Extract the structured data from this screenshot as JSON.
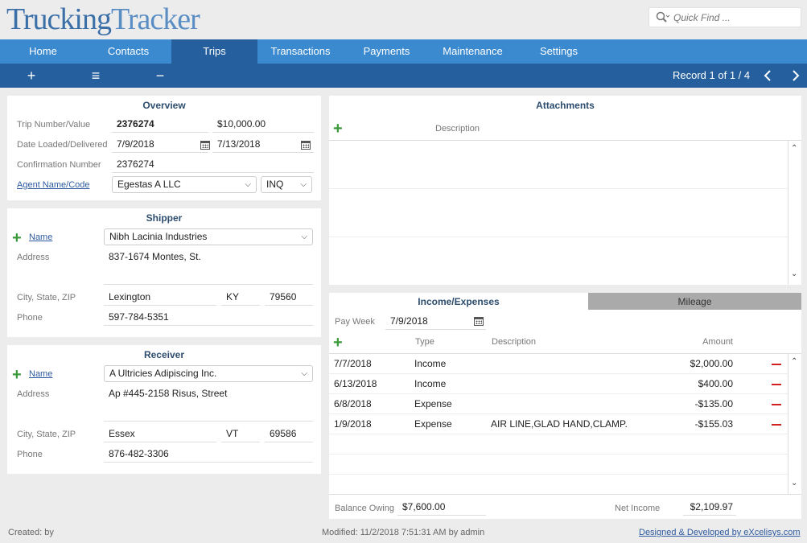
{
  "app": {
    "logo_part1": "Trucking",
    "logo_part2": "Tracker",
    "quick_find_placeholder": "Quick Find ..."
  },
  "nav": {
    "tabs": [
      "Home",
      "Contacts",
      "Trips",
      "Transactions",
      "Payments",
      "Maintenance",
      "Settings"
    ],
    "active": "Trips"
  },
  "toolbar": {
    "add": "+",
    "list": "≡",
    "delete": "−",
    "record": "Record 1 of 1 / 4"
  },
  "overview": {
    "title": "Overview",
    "trip_label": "Trip Number/Value",
    "trip_number": "2376274",
    "trip_value": "$10,000.00",
    "date_label": "Date Loaded/Delivered",
    "date_loaded": "7/9/2018",
    "date_delivered": "7/13/2018",
    "confirm_label": "Confirmation Number",
    "confirm_number": "2376274",
    "agent_label": "Agent Name/Code",
    "agent_name": "Egestas A LLC",
    "agent_code": "INQ"
  },
  "shipper": {
    "title": "Shipper",
    "name_label": "Name",
    "name": "Nibh Lacinia Industries",
    "address_label": "Address",
    "address": "837-1674 Montes, St.",
    "csz_label": "City, State, ZIP",
    "city": "Lexington",
    "state": "KY",
    "zip": "79560",
    "phone_label": "Phone",
    "phone": "597-784-5351"
  },
  "receiver": {
    "title": "Receiver",
    "name_label": "Name",
    "name": "A Ultricies Adipiscing Inc.",
    "address_label": "Address",
    "address": "Ap #445-2158 Risus, Street",
    "csz_label": "City, State, ZIP",
    "city": "Essex",
    "state": "VT",
    "zip": "69586",
    "phone_label": "Phone",
    "phone": "876-482-3306"
  },
  "attachments": {
    "title": "Attachments",
    "desc_header": "Description"
  },
  "income": {
    "tab_income": "Income/Expenses",
    "tab_mileage": "Mileage",
    "pay_week_label": "Pay Week",
    "pay_week": "7/9/2018",
    "col_type": "Type",
    "col_desc": "Description",
    "col_amount": "Amount",
    "rows": [
      {
        "date": "7/7/2018",
        "type": "Income",
        "desc": "",
        "amount": "$2,000.00"
      },
      {
        "date": "6/13/2018",
        "type": "Income",
        "desc": "",
        "amount": "$400.00"
      },
      {
        "date": "6/8/2018",
        "type": "Expense",
        "desc": "",
        "amount": "-$135.00"
      },
      {
        "date": "1/9/2018",
        "type": "Expense",
        "desc": "AIR LINE,GLAD HAND,CLAMP.",
        "amount": "-$155.03"
      }
    ],
    "balance_label": "Balance Owing",
    "balance": "$7,600.00",
    "net_label": "Net Income",
    "net": "$2,109.97"
  },
  "footer": {
    "created": "Created:  by",
    "modified": "Modified: 11/2/2018 7:51:31 AM by admin",
    "credit": "Designed & Developed by eXcelisys.com"
  }
}
